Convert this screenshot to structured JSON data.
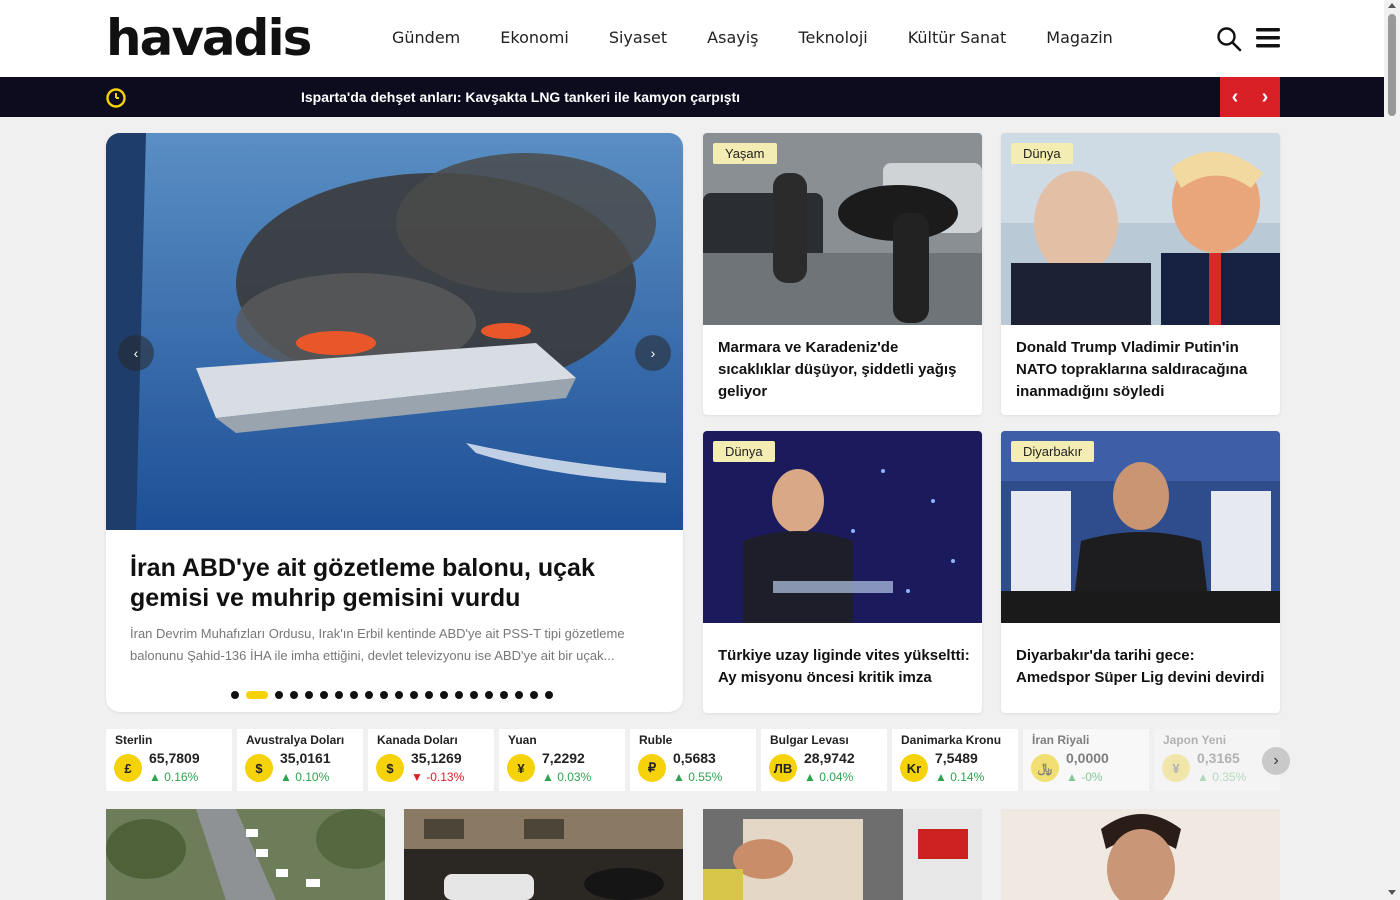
{
  "site": {
    "logo": "havadis"
  },
  "nav": [
    "Gündem",
    "Ekonomi",
    "Siyaset",
    "Asayiş",
    "Teknoloji",
    "Kültür Sanat",
    "Magazin"
  ],
  "icons": {
    "search": "search-icon",
    "menu": "menu-icon",
    "clock": "clock-icon"
  },
  "ticker": {
    "headline": "Isparta'da dehşet anları: Kavşakta LNG tankeri ile kamyon çarpıştı",
    "prev": "‹",
    "next": "›"
  },
  "hero": {
    "title": "İran ABD'ye ait gözetleme balonu, uçak gemisi ve muhrip gemisini vurdu",
    "summary": "İran Devrim Muhafızları Ordusu, Irak'ın Erbil kentinde ABD'ye ait PSS-T tipi gözetleme balonunu Şahid-136 İHA ile imha ettiğini, devlet televizyonu ise ABD'ye ait bir uçak...",
    "prev": "‹",
    "next": "›",
    "slide_count": 21,
    "active_slide": 1
  },
  "cards": [
    {
      "tag": "Yaşam",
      "title": "Marmara ve Karadeniz'de sıcaklıklar düşüyor, şiddetli yağış geliyor"
    },
    {
      "tag": "Dünya",
      "title": "Donald Trump Vladimir Putin'in NATO topraklarına saldıracağına inanmadığını söyledi"
    },
    {
      "tag": "Dünya",
      "title": "Türkiye uzay liginde vites yükseltti: Ay misyonu öncesi kritik imza"
    },
    {
      "tag": "Diyarbakır",
      "title": "Diyarbakır'da tarihi gece: Amedspor Süper Lig devini devirdi"
    }
  ],
  "currencies": [
    {
      "name": "Sterlin",
      "symbol": "£",
      "value": "65,7809",
      "change": "0.16%",
      "direction": "up"
    },
    {
      "name": "Avustralya Doları",
      "symbol": "$",
      "value": "35,0161",
      "change": "0.10%",
      "direction": "up"
    },
    {
      "name": "Kanada Doları",
      "symbol": "$",
      "value": "35,1269",
      "change": "-0.13%",
      "direction": "down"
    },
    {
      "name": "Yuan",
      "symbol": "¥",
      "value": "7,2292",
      "change": "0.03%",
      "direction": "up"
    },
    {
      "name": "Ruble",
      "symbol": "₽",
      "value": "0,5683",
      "change": "0.55%",
      "direction": "up"
    },
    {
      "name": "Bulgar Levası",
      "symbol": "ЛВ",
      "value": "28,9742",
      "change": "0.04%",
      "direction": "up"
    },
    {
      "name": "Danimarka Kronu",
      "symbol": "Kr",
      "value": "7,5489",
      "change": "0.14%",
      "direction": "up"
    },
    {
      "name": "İran Riyali",
      "symbol": "﷼",
      "value": "0,0000",
      "change": "-0%",
      "direction": "up"
    },
    {
      "name": "Japon Yeni",
      "symbol": "¥",
      "value": "0,3165",
      "change": "0.35%",
      "direction": "up"
    }
  ],
  "currency_next": "›",
  "colors": {
    "accent": "#f5d20a",
    "ticker_bg": "#0c0c1e",
    "ticker_ctrl": "#d81f26",
    "tag_bg": "#f3edb4",
    "up": "#2ea44f",
    "down": "#d81f26"
  }
}
